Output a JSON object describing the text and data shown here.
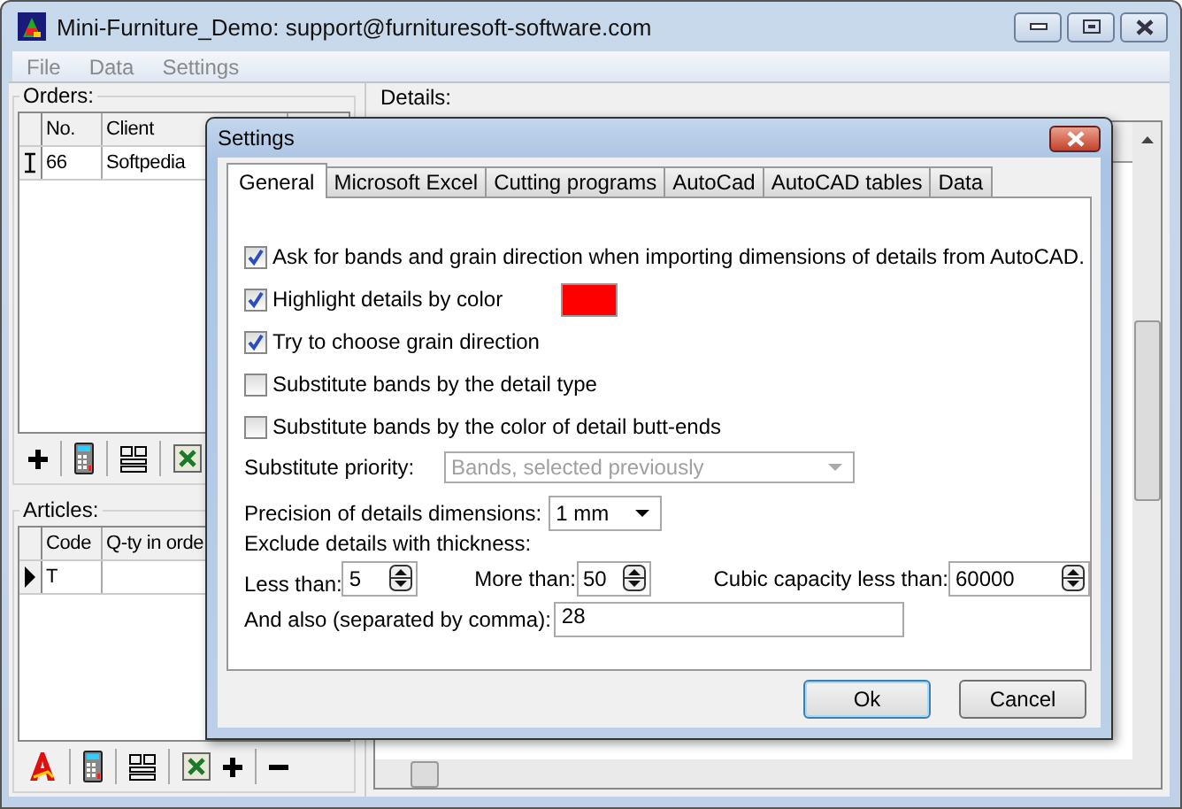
{
  "window": {
    "title": "Mini-Furniture_Demo: support@furnituresoft-software.com"
  },
  "menu": [
    {
      "label": "File",
      "disabled": true
    },
    {
      "label": "Data",
      "disabled": true
    },
    {
      "label": "Settings",
      "disabled": true
    }
  ],
  "orders": {
    "label": "Orders:",
    "columns": [
      "No.",
      "Client"
    ],
    "rows": [
      {
        "cells": [
          "66",
          "Softpedia"
        ],
        "editing": true
      }
    ]
  },
  "articles": {
    "label": "Articles:",
    "columns": [
      "Code",
      "Q-ty in orde"
    ],
    "rows": [
      {
        "cells": [
          "T"
        ],
        "editing": false
      }
    ]
  },
  "details": {
    "label": "Details:"
  },
  "dialog": {
    "title": "Settings",
    "tabs": [
      {
        "label": "General",
        "selected": true
      },
      {
        "label": "Microsoft Excel",
        "selected": false
      },
      {
        "label": "Cutting programs",
        "selected": false
      },
      {
        "label": "AutoCad",
        "selected": false
      },
      {
        "label": "AutoCAD tables",
        "selected": false
      },
      {
        "label": "Data",
        "selected": false
      }
    ],
    "options": [
      {
        "label": "Ask for bands and grain direction when importing dimensions of details from AutoCAD.",
        "checked": true
      },
      {
        "label": "Highlight details by color",
        "checked": true,
        "color": "#ff0000"
      },
      {
        "label": "Try to choose grain direction",
        "checked": true
      },
      {
        "label": "Substitute bands by the detail type",
        "checked": false
      },
      {
        "label": "Substitute bands by the color of detail butt-ends",
        "checked": false
      }
    ],
    "substitute_priority": {
      "label": "Substitute priority:",
      "value": "Bands, selected previously",
      "disabled": true
    },
    "precision": {
      "label": "Precision of details dimensions:",
      "value": "1 mm"
    },
    "exclude": {
      "label": "Exclude details with thickness:",
      "less_than_label": "Less than:",
      "less_than": "5",
      "more_than_label": "More than:",
      "more_than": "50",
      "cubic_label": "Cubic capacity less than:",
      "cubic": "60000"
    },
    "also": {
      "label": "And also (separated by comma):",
      "value": "28"
    },
    "buttons": [
      {
        "label": "Ok",
        "default": true
      },
      {
        "label": "Cancel",
        "default": false
      }
    ]
  }
}
